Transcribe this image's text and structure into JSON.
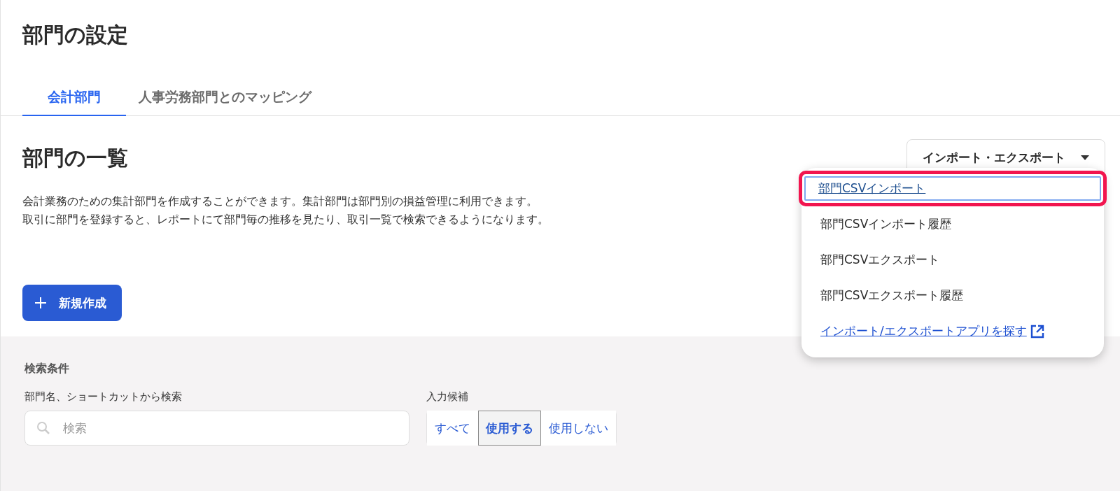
{
  "page": {
    "title": "部門の設定"
  },
  "tabs": [
    {
      "label": "会計部門",
      "selected": true
    },
    {
      "label": "人事労務部門とのマッピング",
      "selected": false
    }
  ],
  "section": {
    "title": "部門の一覧",
    "description": [
      "会計業務のための集計部門を作成することができます。集計部門は部門別の損益管理に利用できます。",
      "取引に部門を登録すると、レポートにて部門毎の推移を見たり、取引一覧で検索できるようになります。"
    ]
  },
  "import_export": {
    "label": "インポート・エクスポート",
    "expanded": true,
    "menu": [
      {
        "label": "部門CSVインポート",
        "kind": "item",
        "selected": true
      },
      {
        "label": "部門CSVインポート履歴",
        "kind": "item",
        "selected": false
      },
      {
        "label": "部門CSVエクスポート",
        "kind": "item",
        "selected": false
      },
      {
        "label": "部門CSVエクスポート履歴",
        "kind": "item",
        "selected": false
      },
      {
        "label": "インポート/エクスポートアプリを探す",
        "kind": "external-link",
        "selected": false
      }
    ]
  },
  "new_button": {
    "label": "新規作成"
  },
  "search": {
    "title": "検索条件",
    "field_label": "部門名、ショートカットから検索",
    "placeholder": "検索",
    "filter_label": "入力候補",
    "filter_options": [
      {
        "label": "すべて",
        "selected": false
      },
      {
        "label": "使用する",
        "selected": true
      },
      {
        "label": "使用しない",
        "selected": false
      }
    ]
  }
}
